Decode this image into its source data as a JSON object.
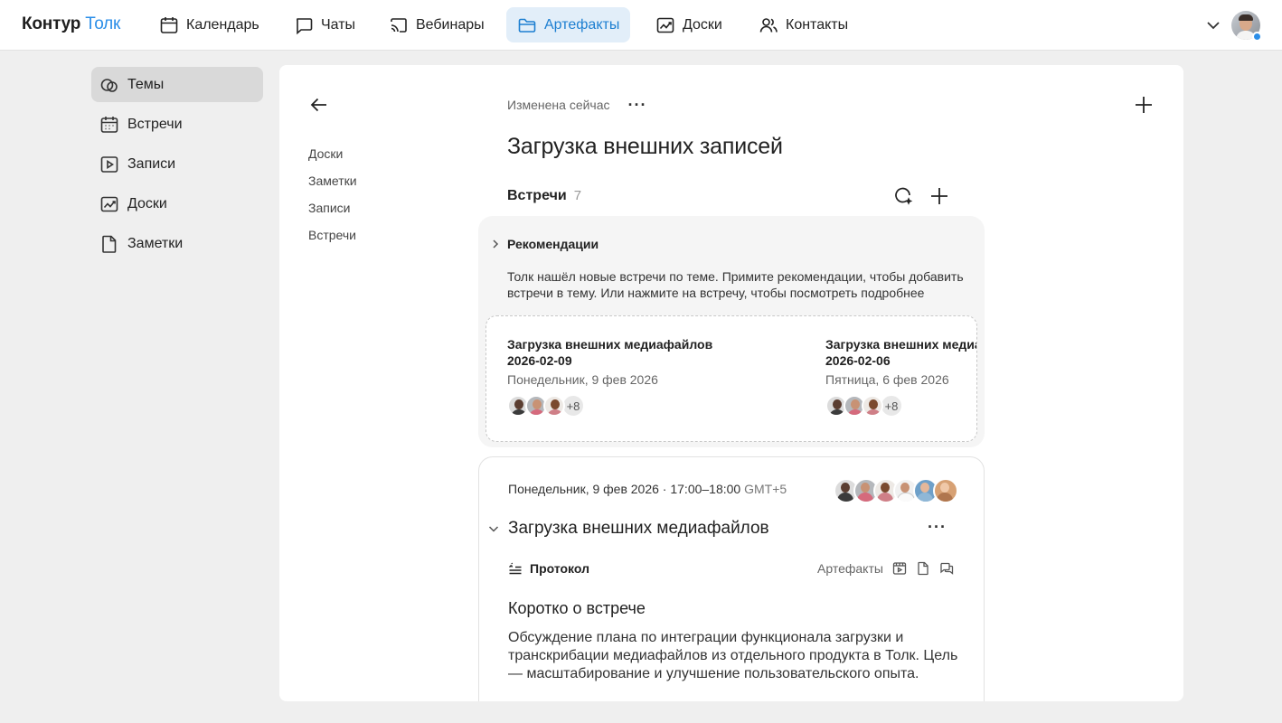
{
  "app": {
    "logo_part1": "Контур",
    "logo_part2": "Толк"
  },
  "nav": {
    "items": [
      {
        "label": "Календарь",
        "icon": "calendar-icon"
      },
      {
        "label": "Чаты",
        "icon": "chat-icon"
      },
      {
        "label": "Вебинары",
        "icon": "cast-icon"
      },
      {
        "label": "Артефакты",
        "icon": "folder-icon",
        "active": true
      },
      {
        "label": "Доски",
        "icon": "board-icon"
      },
      {
        "label": "Контакты",
        "icon": "contacts-icon"
      }
    ]
  },
  "sidebar": {
    "items": [
      {
        "label": "Темы",
        "icon": "topics-icon",
        "active": true
      },
      {
        "label": "Встречи",
        "icon": "calendar-icon"
      },
      {
        "label": "Записи",
        "icon": "play-icon"
      },
      {
        "label": "Доски",
        "icon": "board-icon"
      },
      {
        "label": "Заметки",
        "icon": "note-icon"
      }
    ]
  },
  "toc": [
    "Доски",
    "Заметки",
    "Записи",
    "Встречи"
  ],
  "page": {
    "modified": "Изменена сейчас",
    "title": "Загрузка внешних записей"
  },
  "meetings_section": {
    "title": "Встречи",
    "count": "7"
  },
  "recommendations": {
    "title": "Рекомендации",
    "text": "Толк нашёл новые встречи по теме. Примите рекомендации, чтобы добавить встречи в тему. Или нажмите на встречу, чтобы посмотреть подробнее",
    "items": [
      {
        "name_line1": "Загрузка внешних медиафайлов",
        "name_line2": "2026-02-09",
        "date": "Понедельник, 9 фев 2026",
        "more": "+8"
      },
      {
        "name_line1": "Загрузка внешних медиафайлов",
        "name_line2": "2026-02-06",
        "date": "Пятница, 6 фев 2026",
        "more": "+8"
      }
    ]
  },
  "meeting": {
    "date": "Понедельник, 9 фев 2026 · 17:00–18:00",
    "tz": "GMT+5",
    "title": "Загрузка внешних медиафайлов",
    "protocol_label": "Протокол",
    "artifacts_label": "Артефакты",
    "summary_title": "Коротко о встрече",
    "summary_text": "Обсуждение плана по интеграции функционала загрузки и транскрибации медиафайлов из отдельного продукта в Толк. Цель — масштабирование и улучшение пользовательского опыта."
  },
  "colors": {
    "accent": "#2b8ee8",
    "active_nav_bg": "#e2eef9",
    "sidebar_active_bg": "#d9d9d9"
  }
}
